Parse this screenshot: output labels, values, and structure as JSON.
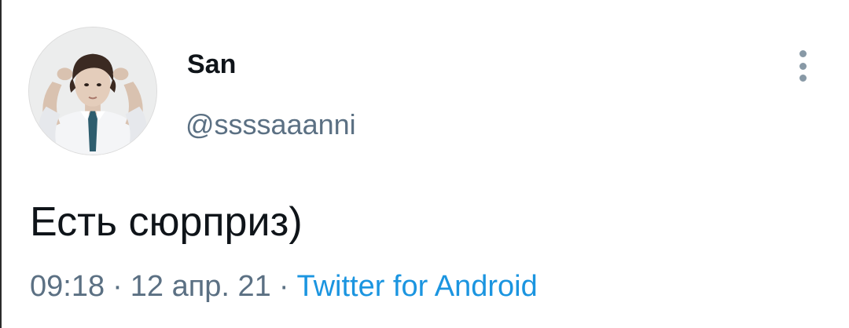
{
  "tweet": {
    "author": {
      "display_name": "San",
      "handle": "@ssssaaanni",
      "avatar_icon": "profile-photo"
    },
    "text": "Есть сюрприз)",
    "time": "09:18",
    "date": "12 апр. 21",
    "separator": "·",
    "source": "Twitter for Android",
    "more_icon": "vertical-ellipsis-icon"
  },
  "colors": {
    "text_primary": "#0f1419",
    "text_secondary": "#5b7083",
    "link": "#1b95e0",
    "background": "#ffffff"
  }
}
